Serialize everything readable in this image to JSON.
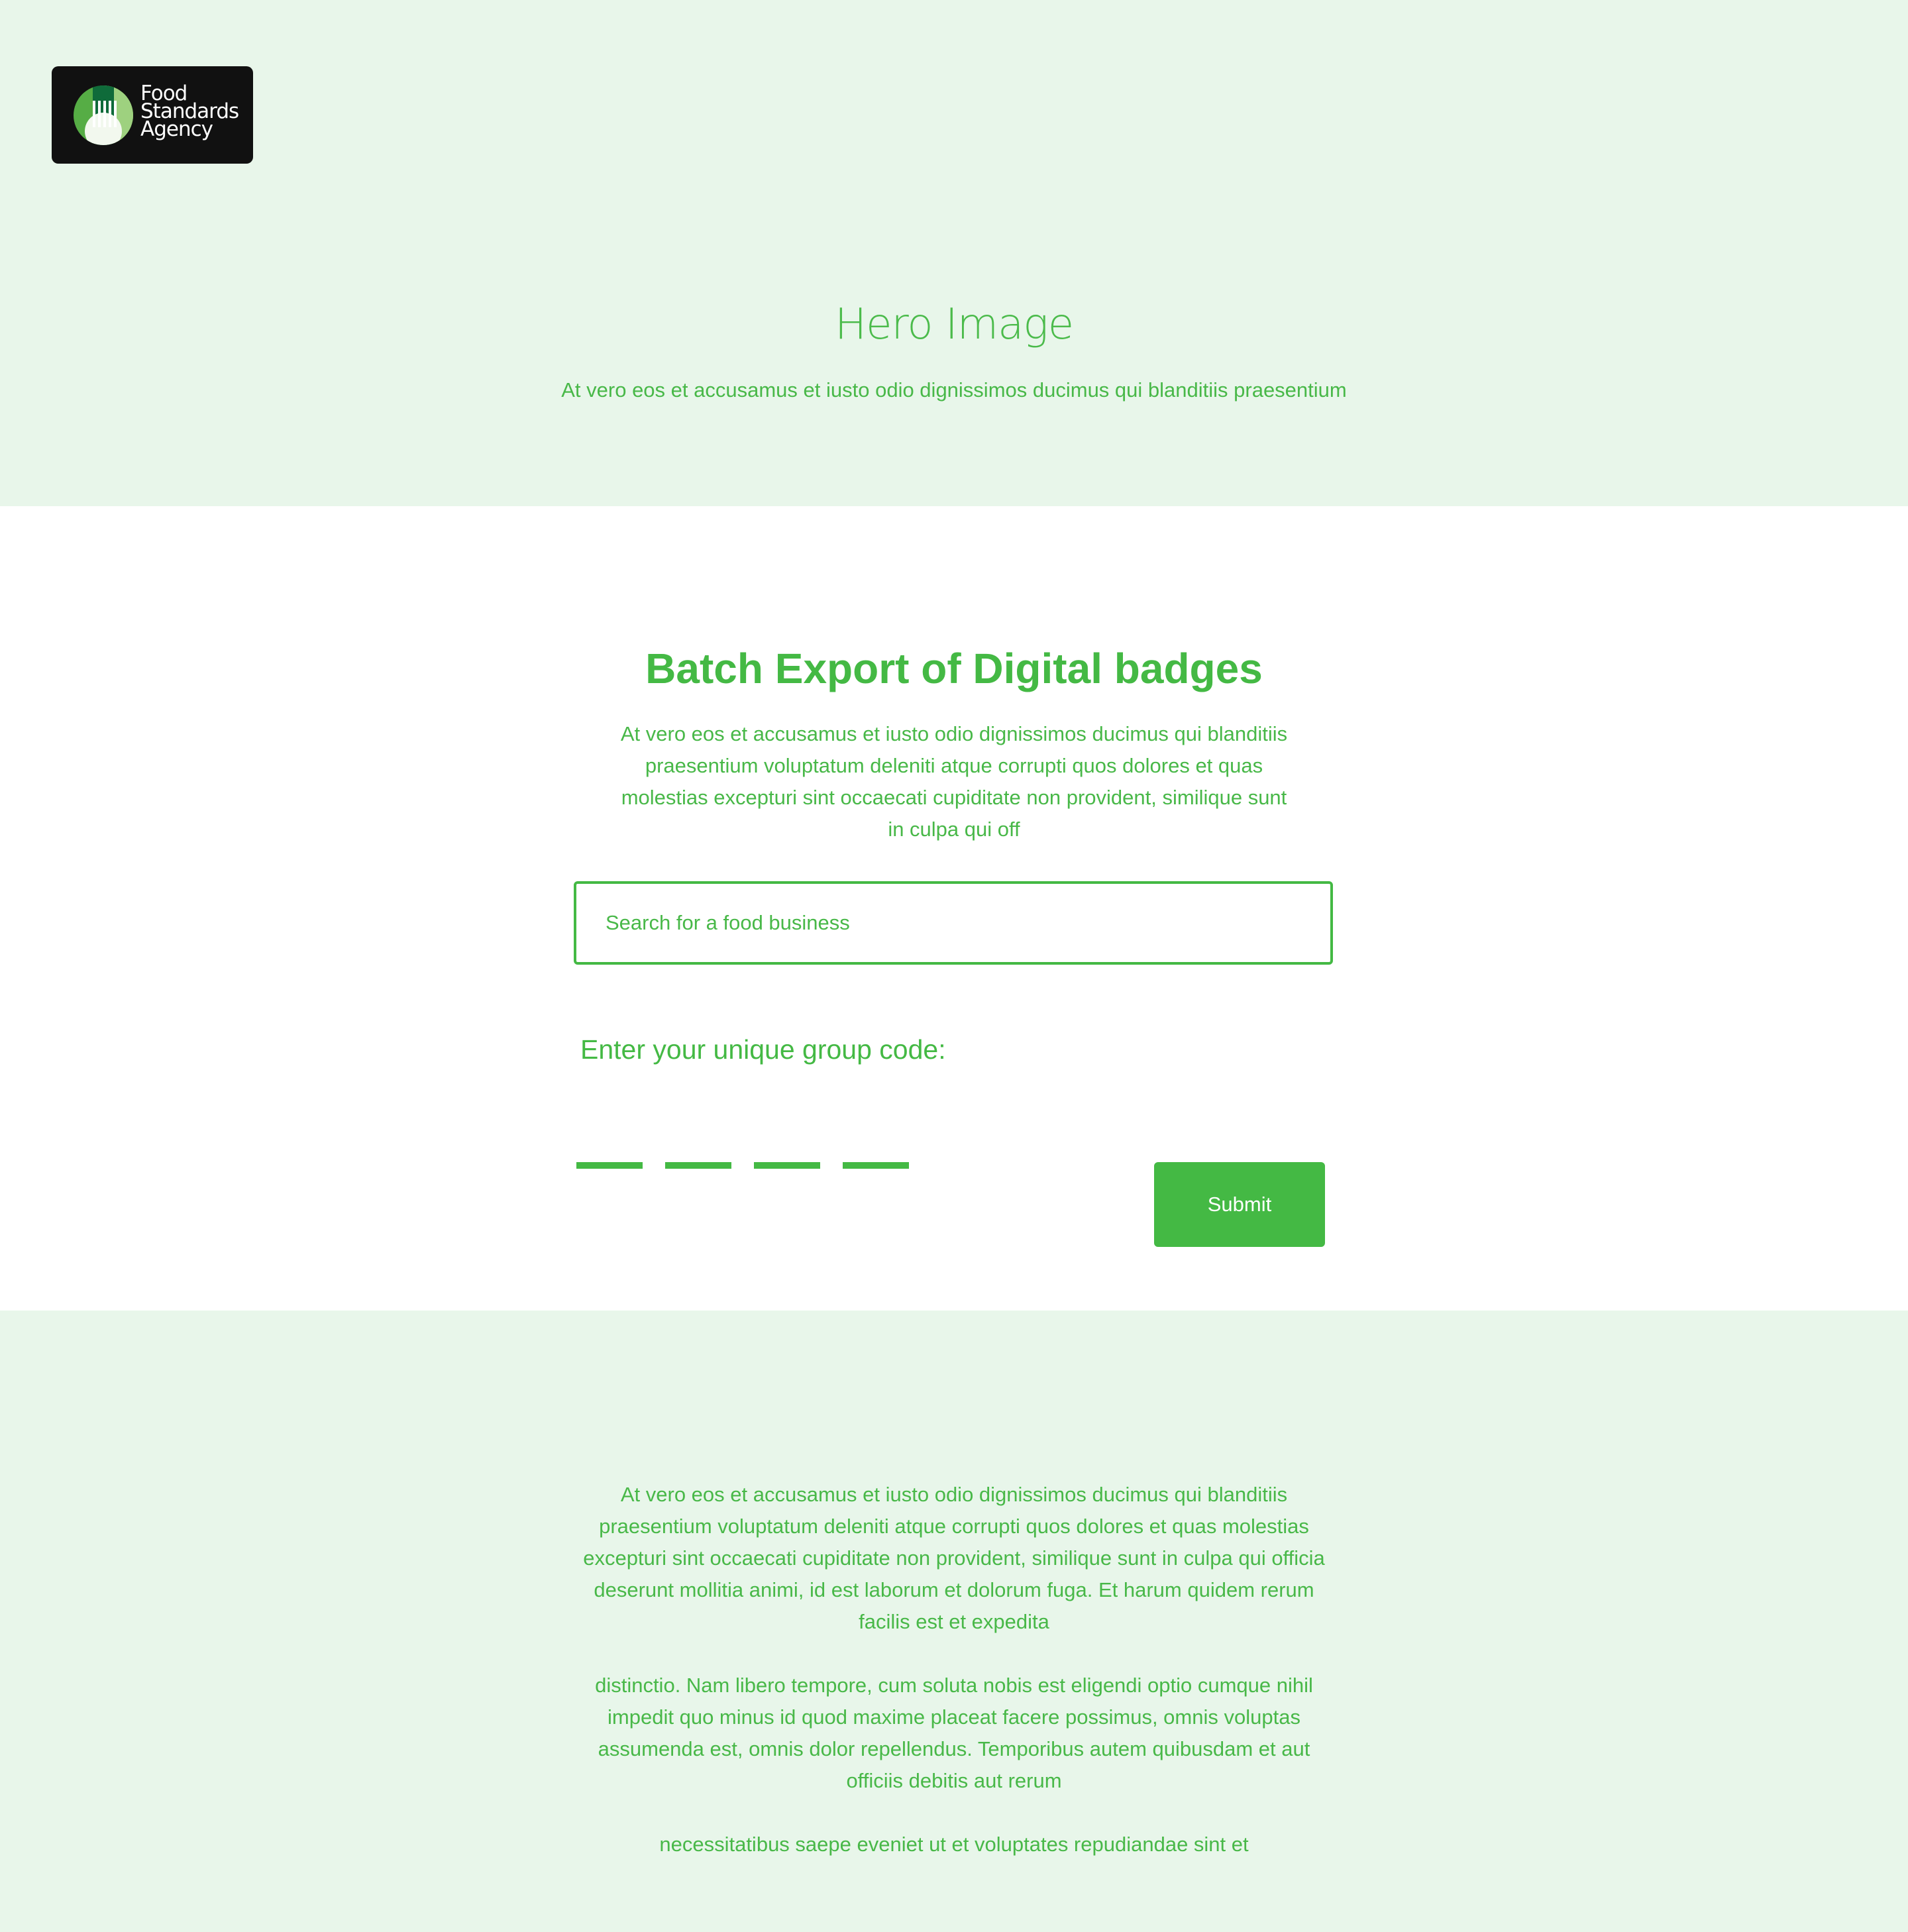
{
  "brand": {
    "logo_lines": [
      "Food",
      "Standards",
      "Agency"
    ]
  },
  "hero": {
    "title": "Hero Image",
    "subtitle": "At vero eos et accusamus et iusto odio dignissimos ducimus qui blanditiis praesentium"
  },
  "main": {
    "title": "Batch Export of Digital badges",
    "description": "At vero eos et accusamus et iusto odio dignissimos ducimus qui blanditiis praesentium voluptatum deleniti atque corrupti quos dolores et quas molestias excepturi sint occaecati cupiditate non provident, similique sunt in culpa qui off",
    "search": {
      "placeholder": "Search for a food business",
      "value": ""
    },
    "code_label": "Enter your unique group code:",
    "code_slots": 4,
    "submit_label": "Submit"
  },
  "footer": {
    "paragraphs": [
      "At vero eos et accusamus et iusto odio dignissimos ducimus qui blanditiis praesentium voluptatum deleniti atque corrupti quos dolores et quas molestias excepturi sint occaecati cupiditate non provident, similique sunt in culpa qui officia deserunt mollitia animi, id est laborum et dolorum fuga. Et harum quidem rerum facilis est et expedita",
      "distinctio. Nam libero tempore, cum soluta nobis est eligendi optio cumque nihil impedit quo minus id quod maxime placeat facere possimus, omnis voluptas assumenda est, omnis dolor repellendus. Temporibus autem quibusdam et aut officiis debitis aut rerum",
      "necessitatibus saepe eveniet ut et voluptates repudiandae sint et"
    ]
  },
  "colors": {
    "accent": "#44b944",
    "hero_background": "#e8f6ea",
    "logo_background": "#111111"
  },
  "icons": {
    "logo_badge": "fork-in-circle-icon"
  }
}
